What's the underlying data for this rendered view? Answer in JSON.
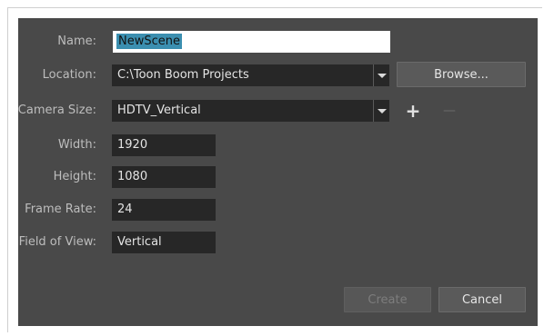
{
  "dialog": {
    "name": {
      "label": "Name:",
      "value": "NewScene"
    },
    "location": {
      "label": "Location:",
      "value": "C:\\Toon Boom Projects",
      "browse_label": "Browse..."
    },
    "camera_size": {
      "label": "Camera Size:",
      "value": "HDTV_Vertical",
      "add_symbol": "+",
      "remove_symbol": "—"
    },
    "width": {
      "label": "Width:",
      "value": "1920"
    },
    "height": {
      "label": "Height:",
      "value": "1080"
    },
    "frame_rate": {
      "label": "Frame Rate:",
      "value": "24"
    },
    "field_of_view": {
      "label": "Field of View:",
      "value": "Vertical"
    },
    "buttons": {
      "create": "Create",
      "cancel": "Cancel"
    }
  },
  "colors": {
    "dialog_bg": "#494949",
    "field_bg": "#272727",
    "selection": "#3b8fb0"
  },
  "icons": [
    "chevron-down-icon",
    "plus-icon",
    "minus-icon"
  ]
}
